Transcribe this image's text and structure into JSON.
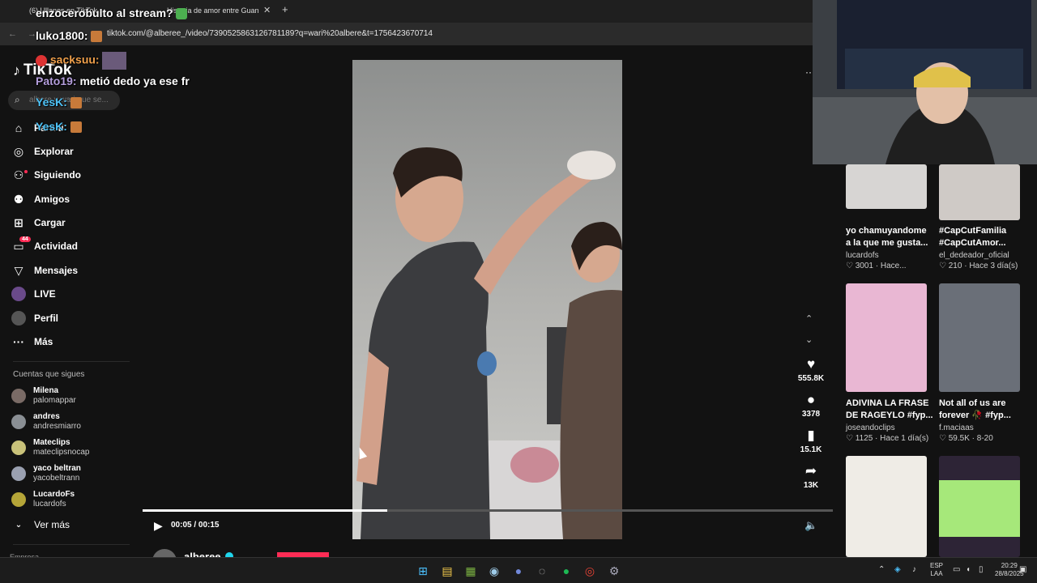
{
  "browser": {
    "tabs": [
      {
        "label": "(6) Ullanes en TikTok..."
      },
      {
        "label": "Historia de amor entre Guan"
      }
    ],
    "new_tab": "+",
    "close": "✕",
    "url": "tiktok.com/@alberee_/video/7390525863126781189?q=wari%20albere&t=1756423670714"
  },
  "sidebar": {
    "brand": "TikTok",
    "search_placeholder": "albere y wari que se...",
    "items": [
      {
        "label": "Para ti",
        "icon": "home-icon"
      },
      {
        "label": "Explorar",
        "icon": "compass-icon"
      },
      {
        "label": "Siguiendo",
        "icon": "following-icon"
      },
      {
        "label": "Amigos",
        "icon": "friends-icon"
      },
      {
        "label": "Cargar",
        "icon": "upload-icon"
      },
      {
        "label": "Actividad",
        "icon": "activity-icon",
        "badge": "44"
      },
      {
        "label": "Mensajes",
        "icon": "messages-icon"
      },
      {
        "label": "LIVE",
        "icon": "live-icon"
      },
      {
        "label": "Perfil",
        "icon": "profile-icon"
      },
      {
        "label": "Más",
        "icon": "more-icon"
      }
    ],
    "following_title": "Cuentas que sigues",
    "following": [
      {
        "name": "Milena",
        "handle": "palomappar"
      },
      {
        "name": "andres",
        "handle": "andresmiarro"
      },
      {
        "name": "Mateclips",
        "handle": "mateclipsnocap"
      },
      {
        "name": "yaco beltran",
        "handle": "yacobeltrann"
      },
      {
        "name": "LucardoFs",
        "handle": "lucardofs"
      }
    ],
    "see_more": "Ver más",
    "footer": "Empresa"
  },
  "player": {
    "current_time": "00:05",
    "duration": "00:15",
    "time_display": "00:05 / 00:15",
    "progress": 0.355,
    "likes": "555.8K",
    "comments": "3378",
    "saves": "15.1K",
    "shares": "13K",
    "author": "alberee_"
  },
  "recommendations": [
    {
      "title": "yo chamuyandome a la que me gusta...",
      "author": "lucardofs",
      "likes": "3001",
      "age": "Hace..."
    },
    {
      "title": "#CapCutFamilia #CapCutAmor...",
      "author": "el_dedeador_oficial",
      "likes": "210",
      "age": "Hace 3 día(s)"
    },
    {
      "title": "ADIVINA LA FRASE DE RAGEYLO #fyp...",
      "author": "joseandoclips",
      "likes": "1125",
      "age": "Hace 1 día(s)"
    },
    {
      "title": "Not all of us are forever 🥀 #fyp...",
      "author": "f.maciaas",
      "likes": "59.5K",
      "age": "8-20"
    },
    {
      "title": "",
      "author": "",
      "likes": "",
      "age": ""
    },
    {
      "title": "",
      "author": "",
      "likes": "",
      "age": ""
    }
  ],
  "chat": [
    {
      "user": "",
      "text": "enzocerobulto al stream?"
    },
    {
      "user": "luko1800:",
      "text": ""
    },
    {
      "user": "sacksuu:",
      "text": ""
    },
    {
      "user": "Pato19:",
      "text": "metió dedo ya ese fr"
    },
    {
      "user": "YesK:",
      "text": ""
    },
    {
      "user": "YesK:",
      "text": ""
    }
  ],
  "taskbar": {
    "lang_1": "ESP",
    "lang_2": "LAA",
    "time": "20:29",
    "date": "28/8/2025"
  },
  "colors": {
    "accent": "#fe2c55",
    "background": "#121212",
    "verified": "#20d5ec"
  }
}
